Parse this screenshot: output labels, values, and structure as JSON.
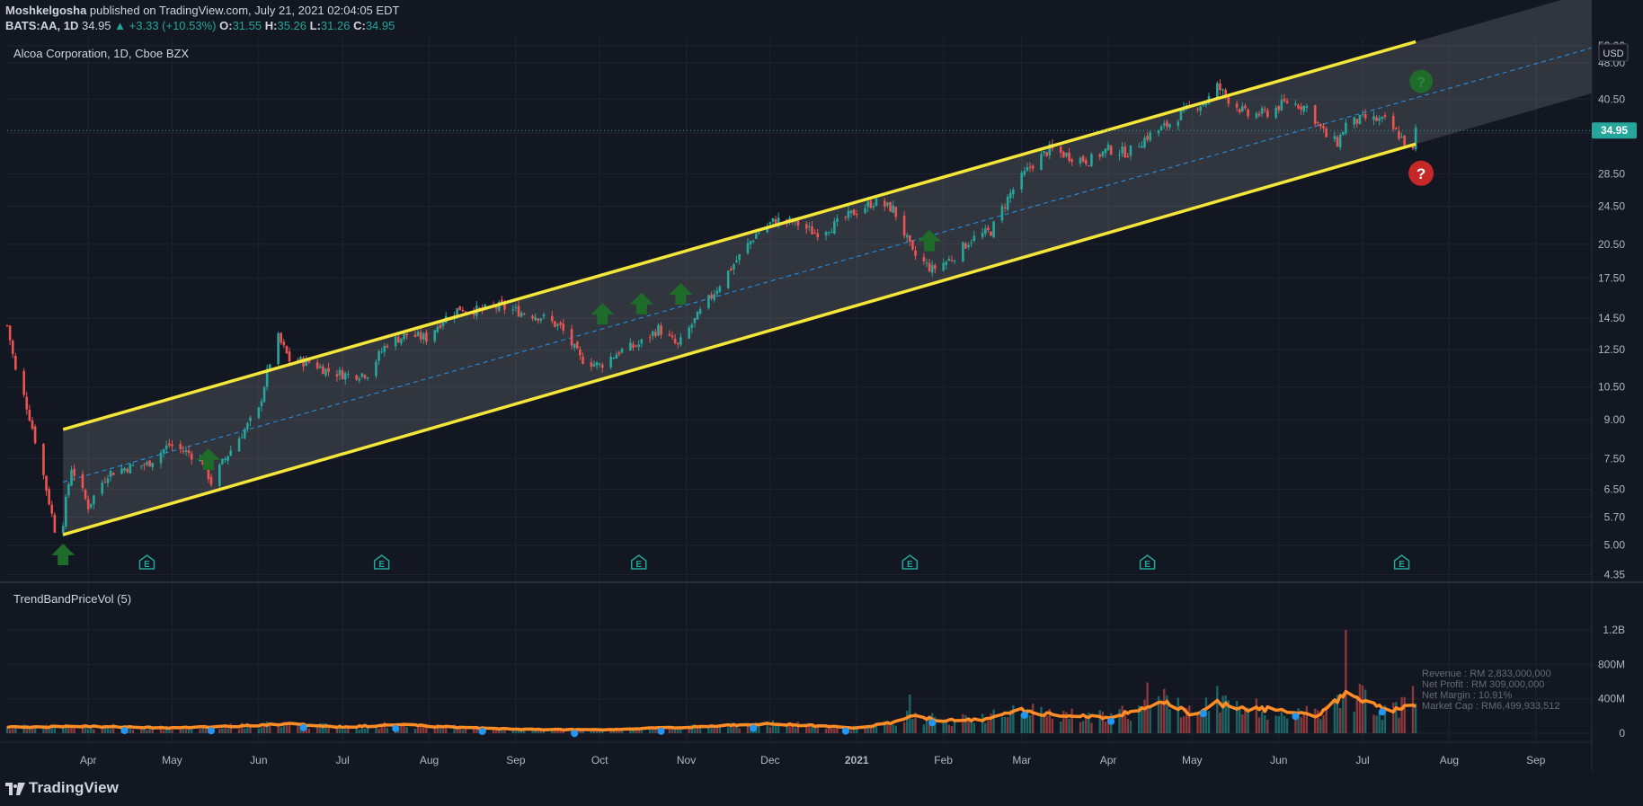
{
  "header": {
    "author": "Moshkelgosha",
    "published": "published on TradingView.com, July 21, 2021 02:04:05 EDT",
    "symbol": "BATS:AA, 1D",
    "last": "34.95",
    "change": "▲ +3.33 (+10.53%)",
    "o_label": "O:",
    "o": "31.55",
    "h_label": "H:",
    "h": "35.26",
    "l_label": "L:",
    "l": "31.26",
    "c_label": "C:",
    "c": "34.95"
  },
  "brand": "TradingView",
  "colors": {
    "background": "#131722",
    "up": "#26a69a",
    "down": "#ef5350",
    "channel": "#f5e63a",
    "midline": "#2196f3",
    "volume_ma": "#ff8c24",
    "arrow": "#1e6b2a",
    "question": "#c62828"
  },
  "chart_data": [
    {
      "type": "candlestick",
      "title": "Alcoa Corporation, 1D, Cboe BZX",
      "currency": "USD",
      "y_scale": "log",
      "ylim": [
        4.2,
        54
      ],
      "y_ticks": [
        "52.00",
        "48.00",
        "40.50",
        "34.50",
        "28.50",
        "24.50",
        "20.50",
        "17.50",
        "14.50",
        "12.50",
        "10.50",
        "9.00",
        "7.50",
        "6.50",
        "5.70",
        "5.00",
        "4.35"
      ],
      "last_price_label": "34.95",
      "x_ticks": [
        "Apr",
        "May",
        "Jun",
        "Jul",
        "Aug",
        "Sep",
        "Oct",
        "Nov",
        "Dec",
        "2021",
        "Feb",
        "Mar",
        "Apr",
        "May",
        "Jun",
        "Jul",
        "Aug",
        "Sep"
      ],
      "x_tick_dates": [
        "2020-04-01",
        "2020-05-01",
        "2020-06-01",
        "2020-07-01",
        "2020-08-01",
        "2020-09-01",
        "2020-10-01",
        "2020-11-01",
        "2020-12-01",
        "2021-01-01",
        "2021-02-01",
        "2021-03-01",
        "2021-04-01",
        "2021-05-01",
        "2021-06-01",
        "2021-07-01",
        "2021-08-01",
        "2021-09-01"
      ],
      "x_range": [
        "2020-03-03",
        "2021-09-21"
      ],
      "price_path": [
        [
          "2020-03-03",
          14.0
        ],
        [
          "2020-03-06",
          11.3
        ],
        [
          "2020-03-10",
          9.6
        ],
        [
          "2020-03-13",
          8.2
        ],
        [
          "2020-03-17",
          6.5
        ],
        [
          "2020-03-20",
          5.4
        ],
        [
          "2020-03-23",
          5.6
        ],
        [
          "2020-03-26",
          7.2
        ],
        [
          "2020-04-01",
          6.0
        ],
        [
          "2020-04-08",
          7.0
        ],
        [
          "2020-04-15",
          7.2
        ],
        [
          "2020-04-22",
          7.3
        ],
        [
          "2020-04-30",
          8.0
        ],
        [
          "2020-05-07",
          7.7
        ],
        [
          "2020-05-12",
          7.4
        ],
        [
          "2020-05-15",
          6.7
        ],
        [
          "2020-05-20",
          7.5
        ],
        [
          "2020-05-27",
          8.6
        ],
        [
          "2020-06-01",
          9.4
        ],
        [
          "2020-06-05",
          11.8
        ],
        [
          "2020-06-08",
          13.2
        ],
        [
          "2020-06-12",
          11.9
        ],
        [
          "2020-06-19",
          11.8
        ],
        [
          "2020-06-26",
          11.3
        ],
        [
          "2020-07-03",
          11.1
        ],
        [
          "2020-07-10",
          11.2
        ],
        [
          "2020-07-17",
          12.9
        ],
        [
          "2020-07-24",
          13.4
        ],
        [
          "2020-07-31",
          13.2
        ],
        [
          "2020-08-06",
          14.4
        ],
        [
          "2020-08-12",
          15.2
        ],
        [
          "2020-08-19",
          15.0
        ],
        [
          "2020-08-26",
          15.3
        ],
        [
          "2020-09-03",
          14.9
        ],
        [
          "2020-09-10",
          14.6
        ],
        [
          "2020-09-17",
          13.9
        ],
        [
          "2020-09-24",
          12.0
        ],
        [
          "2020-10-01",
          11.6
        ],
        [
          "2020-10-08",
          12.4
        ],
        [
          "2020-10-15",
          12.8
        ],
        [
          "2020-10-22",
          13.8
        ],
        [
          "2020-10-29",
          12.7
        ],
        [
          "2020-11-05",
          14.6
        ],
        [
          "2020-11-12",
          16.7
        ],
        [
          "2020-11-19",
          19.0
        ],
        [
          "2020-11-26",
          21.5
        ],
        [
          "2020-12-03",
          23.0
        ],
        [
          "2020-12-10",
          22.7
        ],
        [
          "2020-12-17",
          21.6
        ],
        [
          "2020-12-24",
          22.4
        ],
        [
          "2020-12-31",
          23.8
        ],
        [
          "2021-01-07",
          25.0
        ],
        [
          "2021-01-14",
          24.2
        ],
        [
          "2021-01-21",
          19.6
        ],
        [
          "2021-01-28",
          18.2
        ],
        [
          "2021-02-04",
          19.2
        ],
        [
          "2021-02-11",
          21.0
        ],
        [
          "2021-02-18",
          21.8
        ],
        [
          "2021-02-25",
          26.0
        ],
        [
          "2021-03-04",
          29.5
        ],
        [
          "2021-03-11",
          32.0
        ],
        [
          "2021-03-18",
          31.0
        ],
        [
          "2021-03-25",
          30.3
        ],
        [
          "2021-04-01",
          32.0
        ],
        [
          "2021-04-08",
          31.5
        ],
        [
          "2021-04-15",
          34.0
        ],
        [
          "2021-04-22",
          35.8
        ],
        [
          "2021-04-29",
          38.5
        ],
        [
          "2021-05-06",
          40.0
        ],
        [
          "2021-05-10",
          43.0
        ],
        [
          "2021-05-14",
          40.5
        ],
        [
          "2021-05-21",
          37.5
        ],
        [
          "2021-05-28",
          38.0
        ],
        [
          "2021-06-04",
          40.0
        ],
        [
          "2021-06-11",
          39.0
        ],
        [
          "2021-06-18",
          34.0
        ],
        [
          "2021-06-22",
          33.0
        ],
        [
          "2021-06-25",
          36.0
        ],
        [
          "2021-07-02",
          37.0
        ],
        [
          "2021-07-09",
          36.5
        ],
        [
          "2021-07-14",
          34.2
        ],
        [
          "2021-07-19",
          31.6
        ],
        [
          "2021-07-20",
          34.95
        ]
      ],
      "channel": {
        "upper": [
          [
            "2020-03-23",
            8.6
          ],
          [
            "2021-07-20",
            53.0
          ]
        ],
        "lower": [
          [
            "2020-03-23",
            5.25
          ],
          [
            "2021-07-20",
            32.8
          ]
        ],
        "midline": [
          [
            "2020-03-23",
            6.72
          ],
          [
            "2021-09-21",
            51.5
          ]
        ]
      },
      "support_arrows": [
        "2020-03-23",
        "2020-05-14",
        "2020-10-02",
        "2020-10-16",
        "2020-10-30",
        "2021-01-27"
      ],
      "earnings_dates": [
        "2020-04-22",
        "2020-07-15",
        "2020-10-15",
        "2021-01-20",
        "2021-04-15",
        "2021-07-15"
      ],
      "earnings_marker": "E",
      "annotations": [
        "?"
      ]
    },
    {
      "type": "bar",
      "title": "TrendBandPriceVol (5)",
      "y_ticks": [
        "1.2B",
        "800M",
        "400M",
        "0"
      ],
      "ylim": [
        0,
        1400000000
      ],
      "series": [],
      "volume_profile": [
        [
          "2020-03-03",
          70
        ],
        [
          "2020-04-01",
          80
        ],
        [
          "2020-05-01",
          60
        ],
        [
          "2020-06-01",
          90
        ],
        [
          "2020-06-10",
          110
        ],
        [
          "2020-07-01",
          70
        ],
        [
          "2020-07-20",
          100
        ],
        [
          "2020-08-10",
          70
        ],
        [
          "2020-09-01",
          45
        ],
        [
          "2020-10-01",
          40
        ],
        [
          "2020-11-01",
          70
        ],
        [
          "2020-12-01",
          110
        ],
        [
          "2020-12-15",
          90
        ],
        [
          "2021-01-01",
          60
        ],
        [
          "2021-01-15",
          130
        ],
        [
          "2021-01-20",
          200
        ],
        [
          "2021-02-01",
          150
        ],
        [
          "2021-02-15",
          160
        ],
        [
          "2021-03-01",
          270
        ],
        [
          "2021-03-10",
          220
        ],
        [
          "2021-04-01",
          180
        ],
        [
          "2021-04-15",
          310
        ],
        [
          "2021-04-20",
          380
        ],
        [
          "2021-05-01",
          220
        ],
        [
          "2021-05-10",
          350
        ],
        [
          "2021-05-20",
          280
        ],
        [
          "2021-06-01",
          280
        ],
        [
          "2021-06-15",
          200
        ],
        [
          "2021-06-25",
          470
        ],
        [
          "2021-07-02",
          380
        ],
        [
          "2021-07-10",
          250
        ],
        [
          "2021-07-20",
          330
        ]
      ],
      "volume_spikes": [
        [
          "2021-06-25",
          1200
        ],
        [
          "2021-04-15",
          590
        ],
        [
          "2021-05-10",
          550
        ],
        [
          "2021-01-20",
          450
        ],
        [
          "2021-07-19",
          550
        ]
      ],
      "info_box": [
        "Revenue : RM 2,833,000,000",
        "Net Profit : RM 309,000,000",
        "Net Margin : 10.91%",
        "Market Cap : RM6,499,933,512"
      ]
    }
  ]
}
